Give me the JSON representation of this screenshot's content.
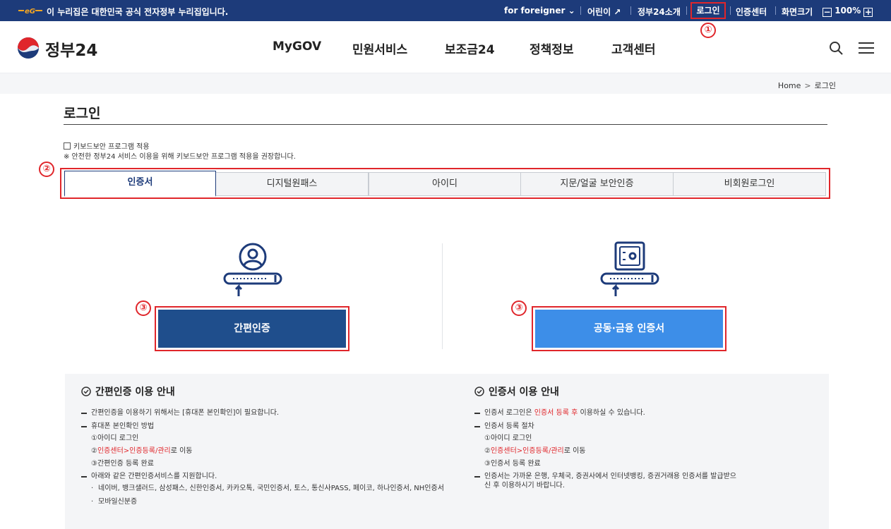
{
  "topbar": {
    "gov_notice": "이 누리집은 대한민국 공식 전자정부 누리집입니다.",
    "foreigner_label": "for foreigner",
    "kids_label": "어린이",
    "intro_label": "정부24소개",
    "login_label": "로그인",
    "cert_center_label": "인증센터",
    "screen_size_label": "화면크기",
    "zoom_minus": "−",
    "zoom_value": "100%",
    "zoom_plus": "+"
  },
  "annotations": {
    "one": "①",
    "two": "②",
    "three": "③"
  },
  "header": {
    "logo_text": "정부24",
    "nav": [
      "MyGOV",
      "민원서비스",
      "보조금24",
      "정책정보",
      "고객센터"
    ]
  },
  "breadcrumb": {
    "home": "Home",
    "separator": ">",
    "current": "로그인"
  },
  "page": {
    "title": "로그인",
    "keyboard_check_label": "키보드보안 프로그램 적용",
    "keyboard_note": "※ 안전한 정부24 서비스 이용을 위해 키보드보안 프로그램 적용을 권장합니다."
  },
  "tabs": [
    "인증서",
    "디지털원패스",
    "아이디",
    "지문/얼굴 보안인증",
    "비회원로그인"
  ],
  "auth": {
    "simple_button": "간편인증",
    "joint_button": "공동·금융 인증서"
  },
  "info": {
    "simple": {
      "title": "간편인증 이용 안내",
      "line1": "간편인증을 이용하기 위해서는 [휴대폰 본인확인]이 필요합니다.",
      "line2": "휴대폰 본인확인 방법",
      "step1": "①아이디 로그인",
      "step2_prefix": "②",
      "step2_link": "인증센터>인증등록/관리",
      "step2_suffix": "로 이동",
      "step3": "③간편인증 등록 완료",
      "line3": "아래와 같은 간편인증서비스를 지원합니다.",
      "bullet1": "네이버, 뱅크샐러드, 삼성패스, 신한인증서, 카카오톡, 국민인증서, 토스, 통신사PASS, 페이코, 하나인증서, NH인증서",
      "bullet2": "모바일신분증"
    },
    "cert": {
      "title": "인증서 이용 안내",
      "line1_prefix": "인증서 로그인은 ",
      "line1_link": "인증서 등록 후",
      "line1_suffix": " 이용하실 수 있습니다.",
      "line2": "인증서 등록 절차",
      "step1": "①아이디 로그인",
      "step2_prefix": "②",
      "step2_link": "인증센터>인증등록/관리",
      "step2_suffix": "로 이동",
      "step3": "③인증서 등록 완료",
      "line3": "인증서는 가까운 은행, 우체국, 증권사에서 인터넷뱅킹, 증권거래용 인증서를 발급받으신 후 이용하시기 바랍니다."
    }
  },
  "colors": {
    "navy": "#1d3b7a",
    "blue_button": "#3d8ee8",
    "dark_button": "#1f4e8c",
    "annotation_red": "#e0262b"
  }
}
